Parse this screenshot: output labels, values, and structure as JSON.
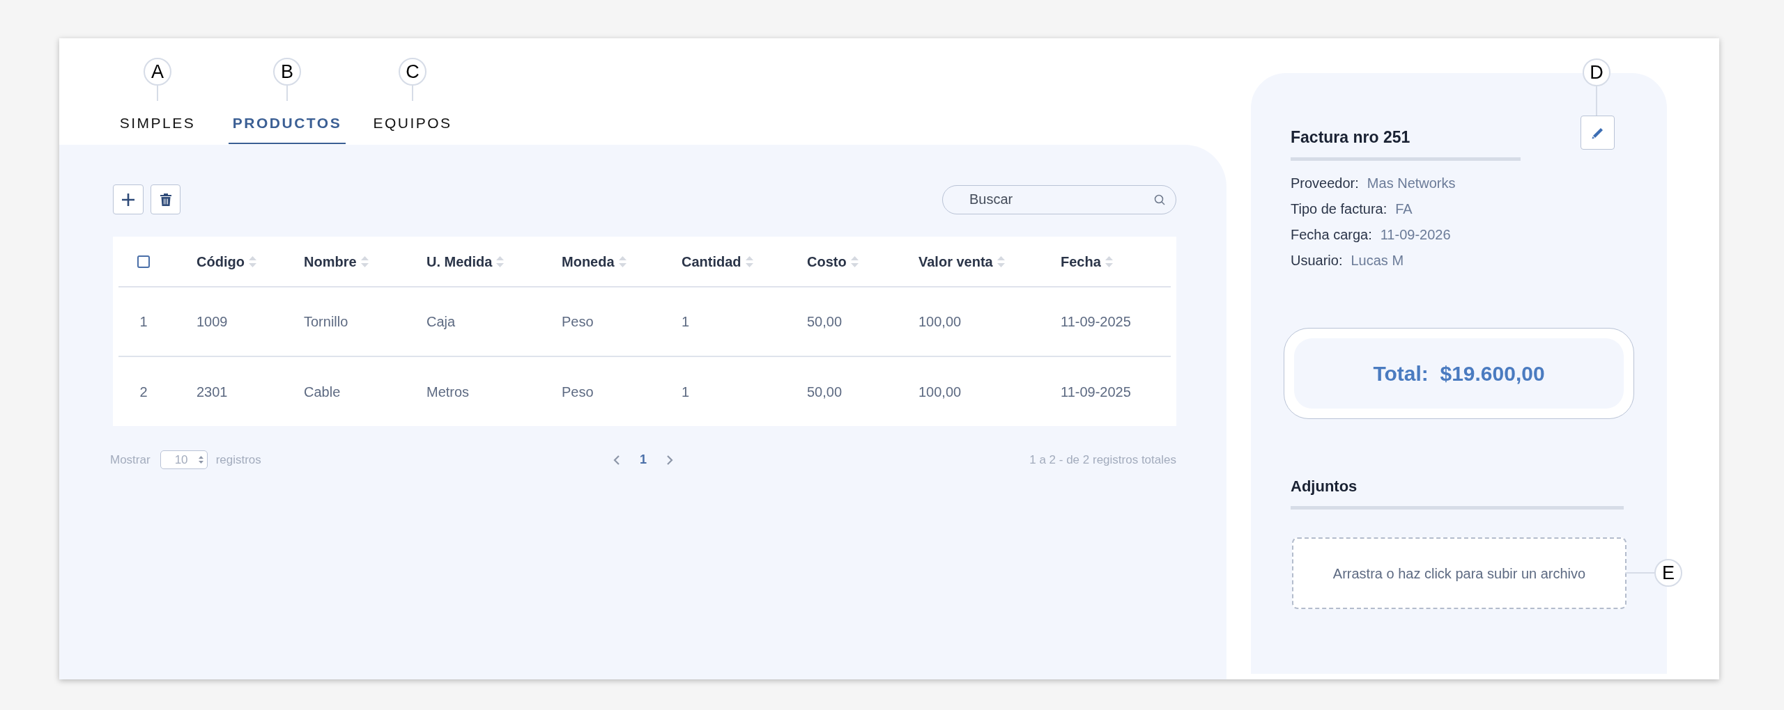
{
  "tabs": [
    {
      "label": "SIMPLES",
      "selected": false,
      "callout": "A"
    },
    {
      "label": "PRODUCTOS",
      "selected": true,
      "callout": "B"
    },
    {
      "label": "EQUIPOS",
      "selected": false,
      "callout": "C"
    }
  ],
  "search": {
    "placeholder": "Buscar"
  },
  "table": {
    "header_checkbox": {
      "checked": false
    },
    "columns": [
      "Código",
      "Nombre",
      "U. Medida",
      "Moneda",
      "Cantidad",
      "Costo",
      "Valor venta",
      "Fecha"
    ],
    "rows": [
      {
        "index": "1",
        "cells": [
          "1009",
          "Tornillo",
          "Caja",
          "Peso",
          "1",
          "50,00",
          "100,00",
          "11-09-2025"
        ]
      },
      {
        "index": "2",
        "cells": [
          "2301",
          "Cable",
          "Metros",
          "Peso",
          "1",
          "50,00",
          "100,00",
          "11-09-2025"
        ]
      }
    ]
  },
  "pagination": {
    "show_label": "Mostrar",
    "page_size": "10",
    "suffix": "registros",
    "pages": [
      {
        "label": "1",
        "selected": true
      }
    ],
    "summary": "1 a 2 - de 2 registros totales"
  },
  "invoice": {
    "title": "Factura nro 251",
    "edit_callout": "D",
    "fields": [
      {
        "label": "Proveedor:",
        "value": "Mas Networks"
      },
      {
        "label": "Tipo de factura:",
        "value": "FA"
      },
      {
        "label": "Fecha carga:",
        "value": "11-09-2026"
      },
      {
        "label": "Usuario:",
        "value": "Lucas M"
      }
    ],
    "total": {
      "label": "Total:",
      "value": "$19.600,00"
    },
    "attachments": {
      "title": "Adjuntos",
      "dropzone": "Arrastra o haz click para subir un archivo",
      "callout": "E"
    }
  }
}
